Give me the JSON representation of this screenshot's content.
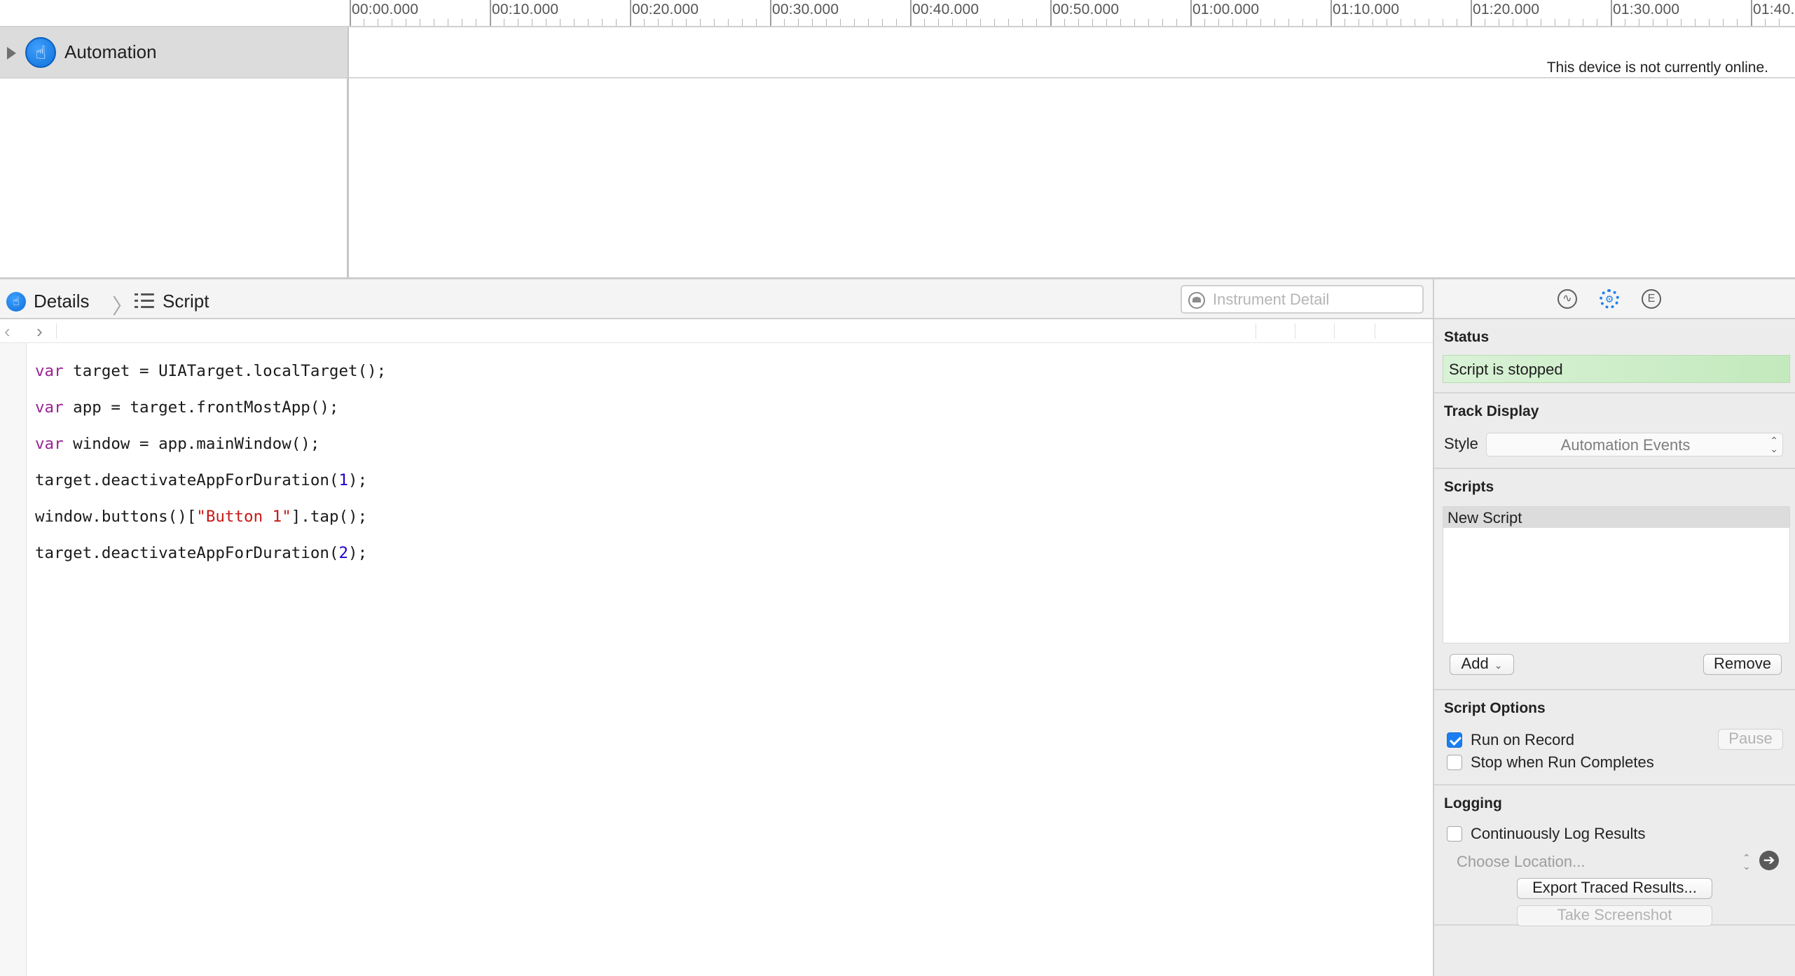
{
  "timeline": {
    "ticks": [
      "00:00.000",
      "00:10.000",
      "00:20.000",
      "00:30.000",
      "00:40.000",
      "00:50.000",
      "01:00.000",
      "01:10.000",
      "01:20.000",
      "01:30.000",
      "01:40."
    ],
    "track_title": "Automation",
    "offline_message": "This device is not currently online."
  },
  "detail_bar": {
    "crumb_details": "Details",
    "crumb_script": "Script",
    "search_placeholder": "Instrument Detail"
  },
  "code": {
    "lines": [
      [
        {
          "t": "kw",
          "v": "var"
        },
        {
          "t": "",
          "v": " target = UIATarget.localTarget();"
        }
      ],
      [
        {
          "t": "kw",
          "v": "var"
        },
        {
          "t": "",
          "v": " app = target.frontMostApp();"
        }
      ],
      [
        {
          "t": "kw",
          "v": "var"
        },
        {
          "t": "",
          "v": " window = app.mainWindow();"
        }
      ],
      [
        {
          "t": "",
          "v": "target.deactivateAppForDuration("
        },
        {
          "t": "num",
          "v": "1"
        },
        {
          "t": "",
          "v": ");"
        }
      ],
      [
        {
          "t": "",
          "v": "window.buttons()["
        },
        {
          "t": "str",
          "v": "\"Button 1\""
        },
        {
          "t": "",
          "v": "].tap();"
        }
      ],
      [
        {
          "t": "",
          "v": "target.deactivateAppForDuration("
        },
        {
          "t": "num",
          "v": "2"
        },
        {
          "t": "",
          "v": ");"
        }
      ]
    ]
  },
  "inspector": {
    "tabs": [
      {
        "name": "record-settings-icon",
        "glyph": "∿"
      },
      {
        "name": "gear-icon",
        "glyph": "⚙"
      },
      {
        "name": "extended-detail-icon",
        "glyph": "E"
      }
    ],
    "status": {
      "title": "Status",
      "value": "Script is stopped"
    },
    "track_display": {
      "title": "Track Display",
      "style_label": "Style",
      "style_value": "Automation Events"
    },
    "scripts": {
      "title": "Scripts",
      "items": [
        "New Script"
      ],
      "add_label": "Add",
      "remove_label": "Remove"
    },
    "script_options": {
      "title": "Script Options",
      "run_on_record": "Run on Record",
      "run_on_record_checked": true,
      "stop_when_complete": "Stop when Run Completes",
      "stop_when_complete_checked": false,
      "pause_label": "Pause"
    },
    "logging": {
      "title": "Logging",
      "continuous_log": "Continuously Log Results",
      "continuous_log_checked": false,
      "location_placeholder": "Choose Location...",
      "export_label": "Export Traced Results...",
      "screenshot_label": "Take Screenshot"
    }
  }
}
